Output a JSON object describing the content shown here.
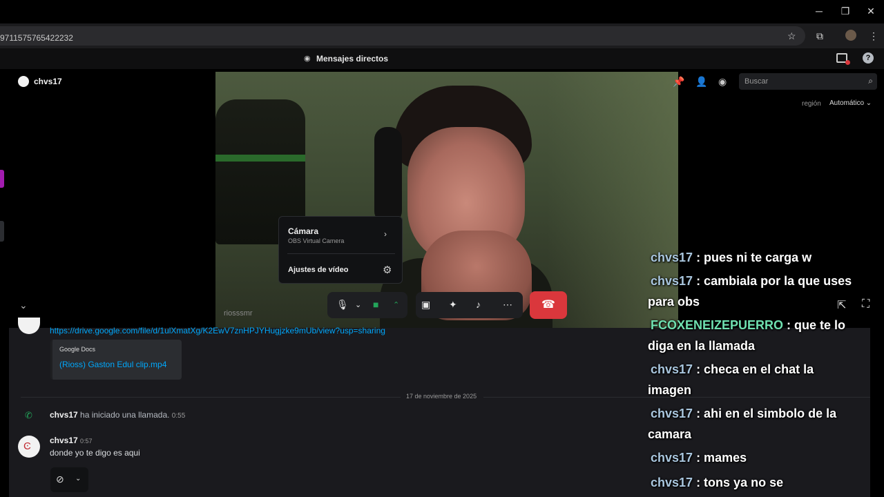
{
  "browser": {
    "url": "9711575765422232",
    "window_controls": [
      "─",
      "❐",
      "✕"
    ],
    "icons": [
      "star-icon",
      "extensions-icon",
      "profile-icon",
      "more-icon"
    ]
  },
  "discord": {
    "dm_title": "Mensajes directos",
    "call_user": "chvs17",
    "search_placeholder": "Buscar",
    "region_label": "región",
    "region_value": "Automático ⌄"
  },
  "video": {
    "participant_label": "riosssmr"
  },
  "camera_menu": {
    "title": "Cámara",
    "device": "OBS Virtual Camera",
    "video_settings": "Ajustes de vídeo"
  },
  "chat": {
    "link": "https://drive.google.com/file/d/1ulXmatXg/K2EwV7znHPJYHugjzke9mUb/view?usp=sharing",
    "embed_provider": "Google Docs",
    "embed_title": "(Rioss) Gaston Edul clip.mp4",
    "date_separator": "17 de noviembre de 2025",
    "system_user": "chvs17",
    "system_text": " ha iniciado una llamada. ",
    "system_time": "0:55",
    "message": {
      "user": "chvs17",
      "time": "0:57",
      "text": "donde yo te digo es aqui"
    }
  },
  "stream_chat": [
    {
      "user": "chvs17",
      "text": " : pues ni te carga w"
    },
    {
      "user": "chvs17",
      "text": " : cambiala por la que uses"
    },
    {
      "user": "",
      "text": "para obs"
    },
    {
      "user": "FCOXENEIZEPUERRO",
      "text": " : que te lo"
    },
    {
      "user": "",
      "text": "diga en la llamada"
    },
    {
      "user": "chvs17",
      "text": " : checa en el chat la"
    },
    {
      "user": "",
      "text": "imagen"
    },
    {
      "user": "chvs17",
      "text": " : ahi en el simbolo de la"
    },
    {
      "user": "",
      "text": "camara"
    },
    {
      "user": "chvs17",
      "text": " : mames"
    },
    {
      "user": "chvs17",
      "text": " : tons ya no se"
    }
  ],
  "colors": {
    "hangup": "#da373c",
    "camera_on": "#23a55a",
    "link": "#00a8fc",
    "stream_user": "#a9c6de",
    "stream_user_alt": "#6fe0b0"
  }
}
